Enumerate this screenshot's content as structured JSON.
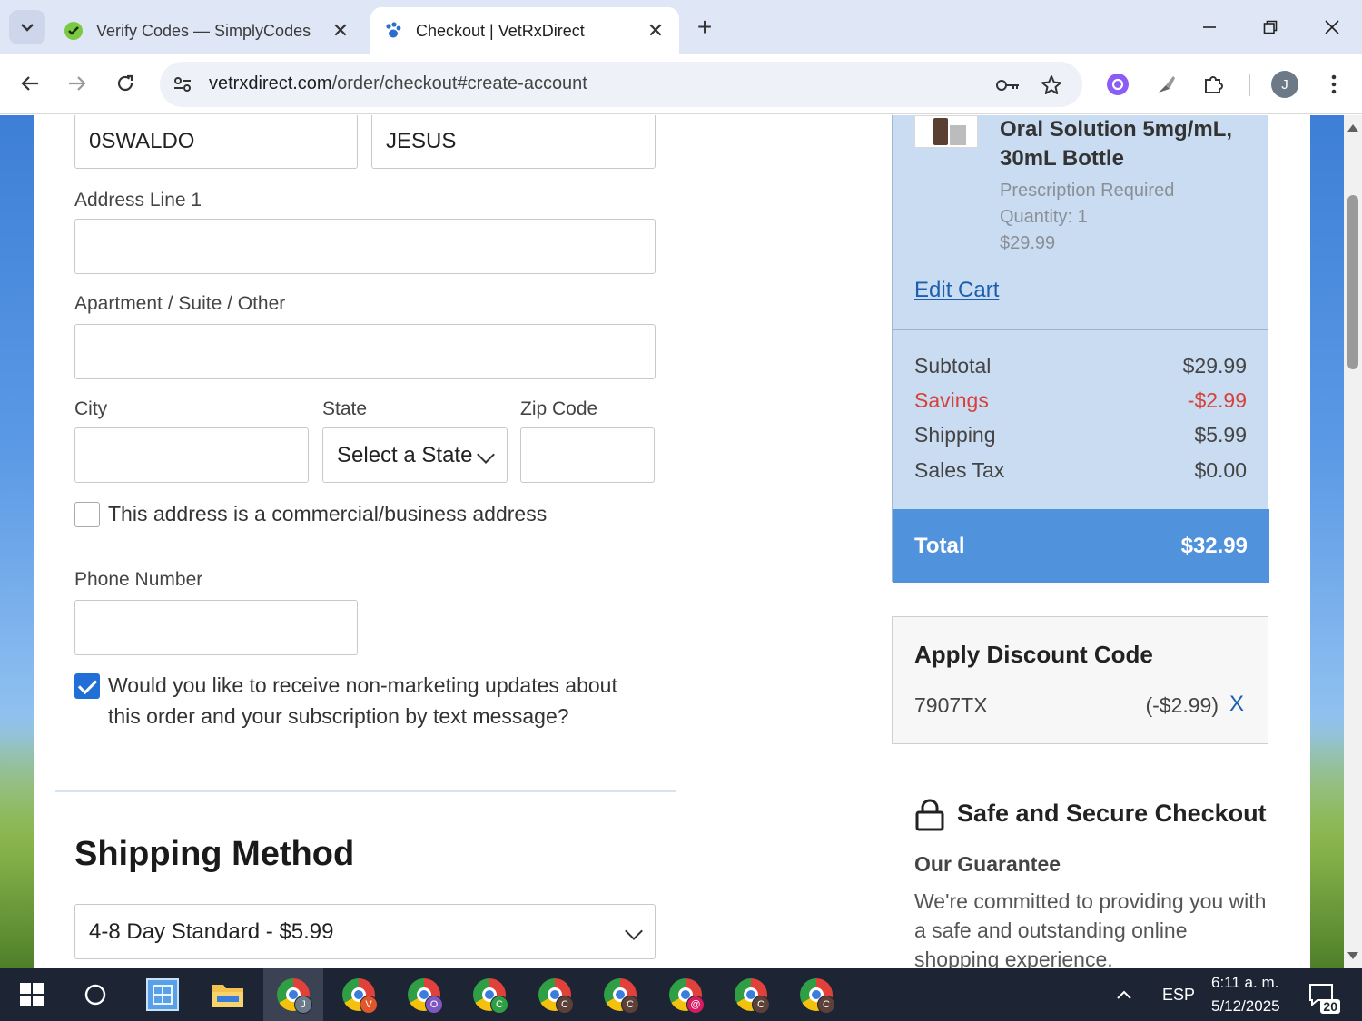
{
  "browser": {
    "tabs": [
      {
        "title": "Verify Codes — SimplyCodes",
        "favicon": "simplycodes-icon",
        "active": false
      },
      {
        "title": "Checkout | VetRxDirect",
        "favicon": "vetrx-paw-icon",
        "active": true
      }
    ],
    "url_domain": "vetrxdirect.com",
    "url_path": "/order/checkout#create-account",
    "profile_initial": "J"
  },
  "form": {
    "first_name_value": "0SWALDO",
    "last_name_value": "JESUS",
    "address1_label": "Address Line 1",
    "address1_value": "",
    "address2_label": "Apartment / Suite / Other",
    "address2_value": "",
    "city_label": "City",
    "city_value": "",
    "state_label": "State",
    "state_selected": "Select a State",
    "zip_label": "Zip Code",
    "zip_value": "",
    "commercial_label": "This address is a commercial/business address",
    "commercial_checked": false,
    "phone_label": "Phone Number",
    "phone_value": "",
    "sms_label_line1": "Would you like to receive non-marketing updates about",
    "sms_label_line2": "this order and your subscription by text message?",
    "sms_checked": true
  },
  "shipping": {
    "title": "Shipping Method",
    "selected": "4-8 Day Standard - $5.99"
  },
  "summary": {
    "product_name": "Oral Solution 5mg/mL, 30mL Bottle",
    "prescription": "Prescription Required",
    "quantity": "Quantity: 1",
    "price": "$29.99",
    "edit_cart": "Edit Cart",
    "rows": [
      {
        "label": "Subtotal",
        "value": "$29.99"
      },
      {
        "label": "Savings",
        "value": "-$2.99"
      },
      {
        "label": "Shipping",
        "value": "$5.99"
      },
      {
        "label": "Sales Tax",
        "value": "$0.00"
      }
    ],
    "total_label": "Total",
    "total_value": "$32.99"
  },
  "discount": {
    "title": "Apply Discount Code",
    "code": "7907TX",
    "amount": "(-$2.99)",
    "remove": "X"
  },
  "secure": {
    "title": "Safe and Secure Checkout",
    "guarantee_title": "Our Guarantee",
    "guarantee_text": "We're committed to providing you with a safe and outstanding online shopping experience."
  },
  "taskbar": {
    "chrome_badges": [
      {
        "letter": "J",
        "color": "#6b7a86"
      },
      {
        "letter": "V",
        "color": "#e2562b"
      },
      {
        "letter": "O",
        "color": "#7e57c2"
      },
      {
        "letter": "C",
        "color": "#2f9e44"
      },
      {
        "letter": "C",
        "color": "#5d4037"
      },
      {
        "letter": "C",
        "color": "#5d4037"
      },
      {
        "letter": "@",
        "color": "#d81b60"
      },
      {
        "letter": "C",
        "color": "#5d4037"
      },
      {
        "letter": "C",
        "color": "#5d4037"
      }
    ],
    "language": "ESP",
    "time": "6:11 a. m.",
    "date": "5/12/2025",
    "notifications": "20"
  },
  "colors": {
    "accent": "#5092dc",
    "summary_bg": "#c9dcf1",
    "savings": "#d6423a",
    "link": "#1b5fae"
  }
}
